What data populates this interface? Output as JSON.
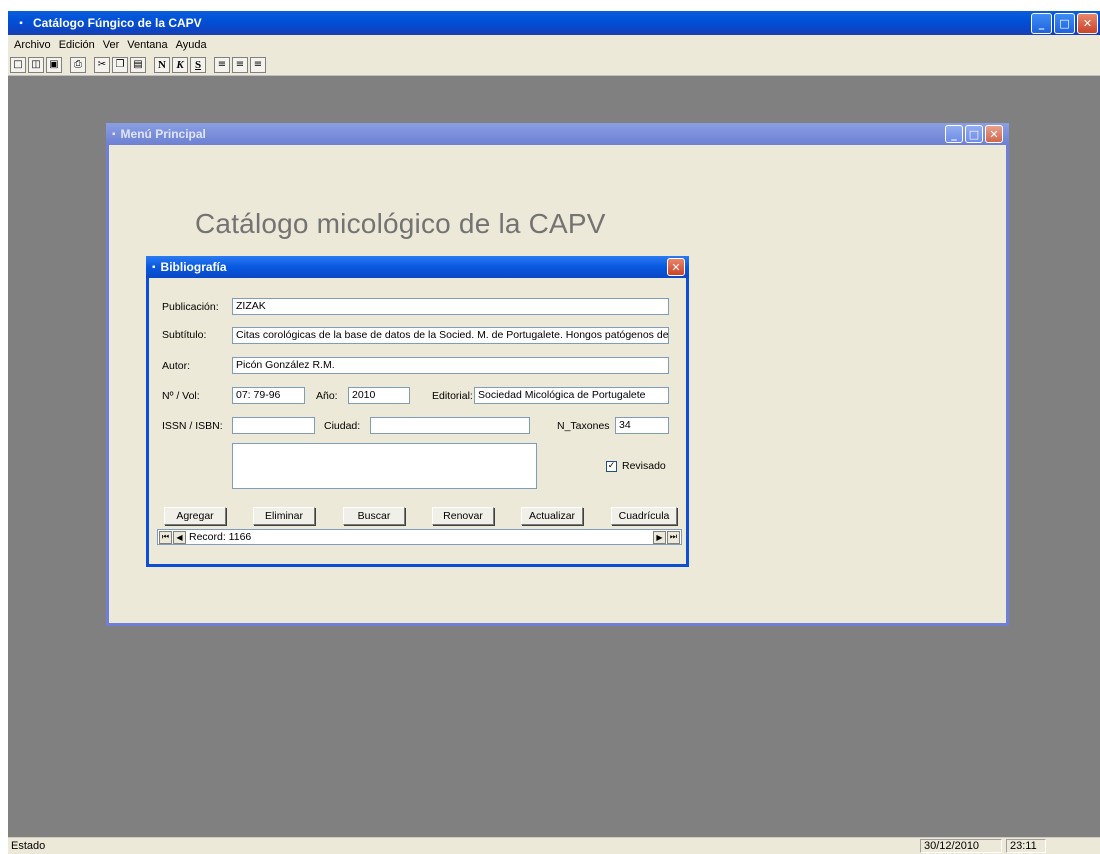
{
  "app": {
    "title": "Catálogo Fúngico de la CAPV",
    "menu": [
      "Archivo",
      "Edición",
      "Ver",
      "Ventana",
      "Ayuda"
    ],
    "toolbar_format": {
      "bold": "N",
      "italic": "K",
      "underline": "S"
    },
    "status": {
      "text": "Estado",
      "date": "30/12/2010",
      "time": "23:11"
    }
  },
  "main_menu": {
    "title": "Menú Principal",
    "heading": "Catálogo micológico de la CAPV"
  },
  "dialog": {
    "title": "Bibliografía",
    "labels": {
      "publicacion": "Publicación:",
      "subtitulo": "Subtítulo:",
      "autor": "Autor:",
      "nvol": "Nº / Vol:",
      "anio": "Año:",
      "editorial": "Editorial:",
      "issn": "ISSN / ISBN:",
      "ciudad": "Ciudad:",
      "ntaxones": "N_Taxones",
      "revisado": "Revisado"
    },
    "values": {
      "publicacion": "ZIZAK",
      "subtitulo": "Citas corológicas de la base de datos de la Socied. M. de Portugalete. Hongos patógenos de las plantas I",
      "autor": "Picón González R.M.",
      "nvol": "07: 79-96",
      "anio": "2010",
      "editorial": "Sociedad Micológica de Portugalete",
      "issn": "",
      "ciudad": "",
      "ntaxones": "34",
      "notes": "",
      "revisado": true
    },
    "buttons": {
      "agregar": "Agregar",
      "eliminar": "Eliminar",
      "buscar": "Buscar",
      "renovar": "Renovar",
      "actualizar": "Actualizar",
      "cuadricula": "Cuadrícula"
    },
    "navigator": {
      "record_text": "Record: 1166"
    }
  }
}
